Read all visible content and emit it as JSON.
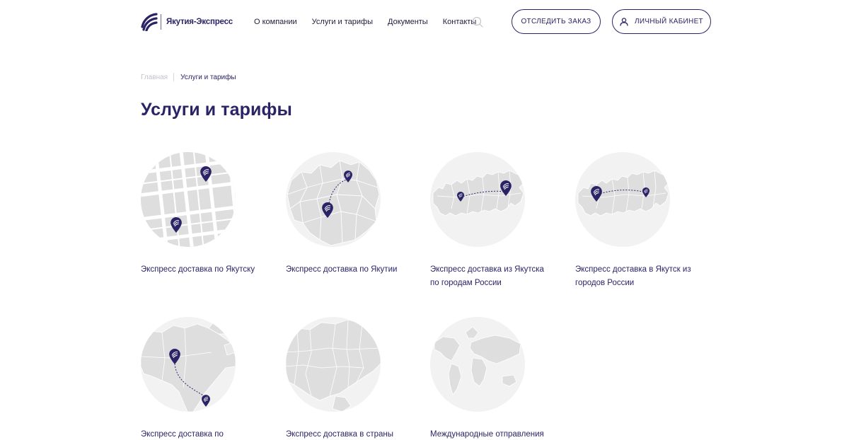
{
  "header": {
    "logo_text": "Якутия-Экспресс",
    "nav": [
      "О компании",
      "Услуги и тарифы",
      "Документы",
      "Контакты"
    ],
    "track_button": "ОТСЛЕДИТЬ ЗАКАЗ",
    "cabinet_button": "ЛИЧНЫЙ КАБИНЕТ"
  },
  "breadcrumb": {
    "home": "Главная",
    "current": "Услуги и тарифы"
  },
  "page_title": "Услуги и тарифы",
  "services": [
    {
      "label": "Экспресс доставка по Якутску",
      "icon": "city-map-icon"
    },
    {
      "label": "Экспресс доставка по Якутии",
      "icon": "yakutia-map-icon"
    },
    {
      "label": "Экспресс доставка из Якутска по городам России",
      "icon": "russia-map-icon"
    },
    {
      "label": "Экспресс доставка в Якутск из городов России",
      "icon": "russia-map-icon"
    },
    {
      "label": "Экспресс доставка по",
      "icon": "america-map-icon"
    },
    {
      "label": "Экспресс доставка в страны",
      "icon": "eurasia-map-icon"
    },
    {
      "label": "Международные отправления",
      "icon": "world-map-icon"
    }
  ],
  "colors": {
    "brand": "#2a2466",
    "map_bg": "#f2f2f2",
    "land": "#dedede"
  }
}
